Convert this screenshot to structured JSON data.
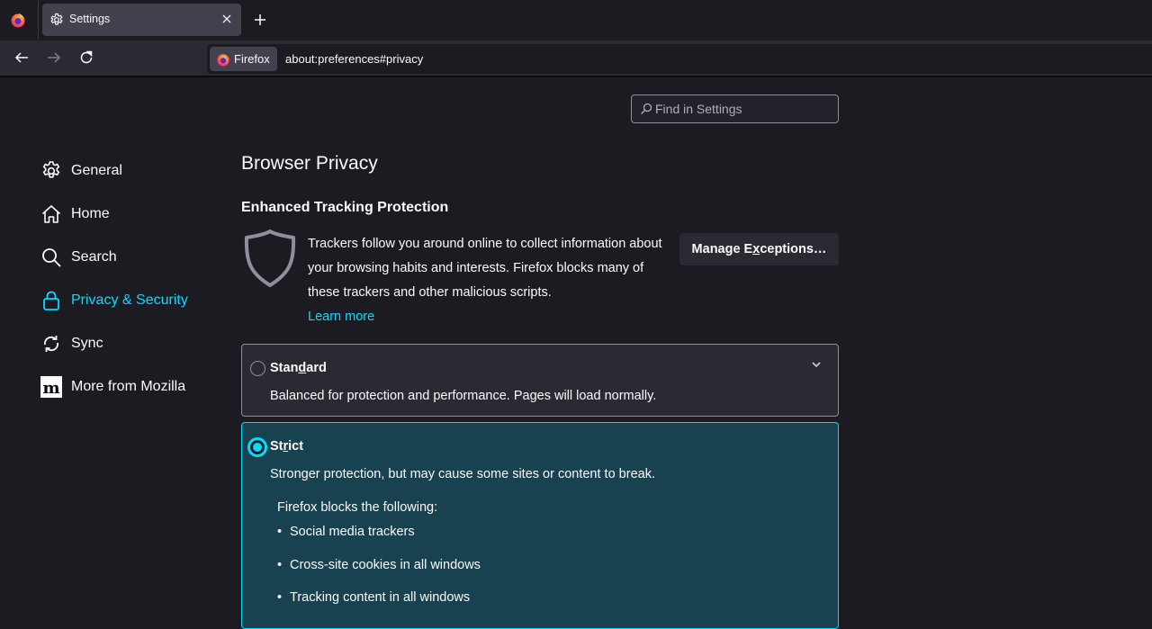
{
  "tabstrip": {
    "tab_title": "Settings",
    "icons": {
      "browser_logo": "firefox-logo-icon",
      "tab_icon": "gear-icon",
      "close": "close-icon",
      "new_tab": "plus-icon"
    }
  },
  "navbar": {
    "identity_label": "Firefox",
    "url": "about:preferences#privacy",
    "icons": {
      "back": "back-arrow-icon",
      "forward": "forward-arrow-icon",
      "reload": "reload-icon"
    }
  },
  "search": {
    "placeholder": "Find in Settings",
    "value": ""
  },
  "sidebar": {
    "items": [
      {
        "label": "General",
        "icon": "gear-icon",
        "active": false
      },
      {
        "label": "Home",
        "icon": "home-icon",
        "active": false
      },
      {
        "label": "Search",
        "icon": "search-icon",
        "active": false
      },
      {
        "label": "Privacy & Security",
        "icon": "lock-icon",
        "active": true
      },
      {
        "label": "Sync",
        "icon": "sync-icon",
        "active": false
      },
      {
        "label": "More from Mozilla",
        "icon": "mozilla-m-icon",
        "active": false
      }
    ]
  },
  "main": {
    "page_title": "Browser Privacy",
    "etp": {
      "title": "Enhanced Tracking Protection",
      "description": "Trackers follow you around online to collect information about your browsing habits and interests. Firefox blocks many of these trackers and other malicious scripts.",
      "learn_more": "Learn more",
      "manage_button": {
        "before": "Manage E",
        "accesskey": "x",
        "after": "ceptions…"
      }
    },
    "options": {
      "standard": {
        "label_before": "Stan",
        "accesskey": "d",
        "label_after": "ard",
        "description": "Balanced for protection and performance. Pages will load normally.",
        "selected": false
      },
      "strict": {
        "label_before": "St",
        "accesskey": "r",
        "label_after": "ict",
        "description": "Stronger protection, but may cause some sites or content to break.",
        "blocks_title": "Firefox blocks the following:",
        "blocks": [
          "Social media trackers",
          "Cross-site cookies in all windows",
          "Tracking content in all windows"
        ],
        "selected": true
      }
    }
  },
  "colors": {
    "accent": "#00ddff",
    "background": "#1c1b22",
    "toolbar": "#2b2a33",
    "selected_option": "#184250"
  }
}
